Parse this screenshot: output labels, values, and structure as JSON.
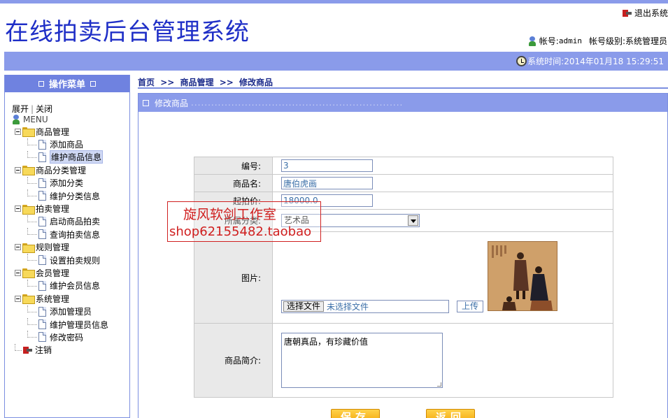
{
  "header": {
    "app_title": "在线拍卖后台管理系统",
    "logout_label": "退出系统",
    "account_prefix": "帐号:",
    "account_name": "admin",
    "account_level": "帐号级别:系统管理员",
    "system_time": "系统时间:2014年01月18 15:29:51"
  },
  "sidebar": {
    "title": "操作菜单",
    "expand_label": "展开",
    "separator": "|",
    "collapse_label": "关闭",
    "root_label": "MENU",
    "groups": [
      {
        "label": "商品管理",
        "items": [
          "添加商品",
          "维护商品信息"
        ]
      },
      {
        "label": "商品分类管理",
        "items": [
          "添加分类",
          "维护分类信息"
        ]
      },
      {
        "label": "拍卖管理",
        "items": [
          "启动商品拍卖",
          "查询拍卖信息"
        ]
      },
      {
        "label": "规则管理",
        "items": [
          "设置拍卖规则"
        ]
      },
      {
        "label": "会员管理",
        "items": [
          "维护会员信息"
        ]
      },
      {
        "label": "系统管理",
        "items": [
          "添加管理员",
          "维护管理员信息",
          "修改密码"
        ]
      }
    ],
    "logout_label": "注销",
    "selected_item": "维护商品信息"
  },
  "breadcrumb": {
    "home": "首页",
    "sep": ">>",
    "section": "商品管理",
    "current": "修改商品"
  },
  "panel": {
    "title": "修改商品",
    "dots": "..............................................................."
  },
  "form": {
    "id_label": "编号:",
    "id_value": "3",
    "name_label": "商品名:",
    "name_value": "唐伯虎画",
    "price_label": "起拍价:",
    "price_value": "18000.0",
    "category_label": "所属分类:",
    "category_value": "艺术品",
    "image_label": "图片:",
    "file_button": "选择文件",
    "file_status": "未选择文件",
    "upload_button": "上传",
    "desc_label": "商品简介:",
    "desc_value": "唐朝真品，有珍藏价值",
    "save_button": "保存",
    "back_button": "返回"
  },
  "watermark": {
    "line1": "旋风软剑工作室",
    "line2": "shop62155482.taobao"
  },
  "colors": {
    "accent": "#8a9bea",
    "title_blue": "#1f2fc7",
    "button_orange": "#f2a000",
    "watermark_red": "#d02020"
  }
}
